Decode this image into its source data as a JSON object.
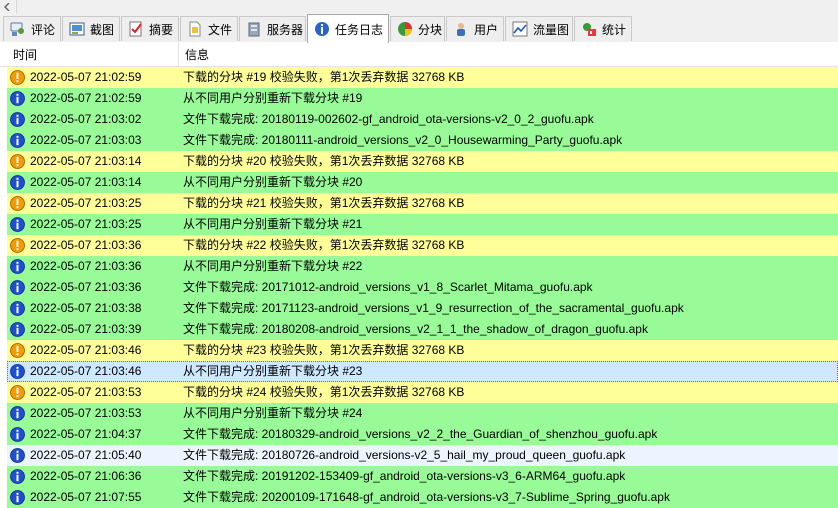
{
  "tabs": [
    {
      "label": "评论",
      "icon": "comment-icon",
      "active": false
    },
    {
      "label": "截图",
      "icon": "screenshot-icon",
      "active": false
    },
    {
      "label": "摘要",
      "icon": "summary-icon",
      "active": false
    },
    {
      "label": "文件",
      "icon": "file-icon",
      "active": false
    },
    {
      "label": "服务器",
      "icon": "server-icon",
      "active": false
    },
    {
      "label": "任务日志",
      "icon": "task-log-icon",
      "active": true
    },
    {
      "label": "分块",
      "icon": "chunk-pie-icon",
      "active": false
    },
    {
      "label": "用户",
      "icon": "user-icon",
      "active": false
    },
    {
      "label": "流量图",
      "icon": "traffic-chart-icon",
      "active": false
    },
    {
      "label": "统计",
      "icon": "statistics-icon",
      "active": false
    }
  ],
  "table": {
    "columns": [
      "时间",
      "信息"
    ],
    "rows": [
      {
        "type": "warn",
        "icon": "warning-icon",
        "time": "2022-05-07 21:02:59",
        "message": "下载的分块 #19 校验失败，第1次丢弃数据 32768 KB"
      },
      {
        "type": "ok",
        "icon": "info-icon",
        "time": "2022-05-07 21:02:59",
        "message": "从不同用户分别重新下载分块 #19"
      },
      {
        "type": "ok",
        "icon": "info-icon",
        "time": "2022-05-07 21:03:02",
        "message": "文件下载完成: 20180119-002602-gf_android_ota-versions-v2_0_2_guofu.apk"
      },
      {
        "type": "ok",
        "icon": "info-icon",
        "time": "2022-05-07 21:03:03",
        "message": "文件下载完成: 20180111-android_versions_v2_0_Housewarming_Party_guofu.apk"
      },
      {
        "type": "warn",
        "icon": "warning-icon",
        "time": "2022-05-07 21:03:14",
        "message": "下载的分块 #20 校验失败，第1次丢弃数据 32768 KB"
      },
      {
        "type": "ok",
        "icon": "info-icon",
        "time": "2022-05-07 21:03:14",
        "message": "从不同用户分别重新下载分块 #20"
      },
      {
        "type": "warn",
        "icon": "warning-icon",
        "time": "2022-05-07 21:03:25",
        "message": "下载的分块 #21 校验失败，第1次丢弃数据 32768 KB"
      },
      {
        "type": "ok",
        "icon": "info-icon",
        "time": "2022-05-07 21:03:25",
        "message": "从不同用户分别重新下载分块 #21"
      },
      {
        "type": "warn",
        "icon": "warning-icon",
        "time": "2022-05-07 21:03:36",
        "message": "下载的分块 #22 校验失败，第1次丢弃数据 32768 KB"
      },
      {
        "type": "ok",
        "icon": "info-icon",
        "time": "2022-05-07 21:03:36",
        "message": "从不同用户分别重新下载分块 #22"
      },
      {
        "type": "ok",
        "icon": "info-icon",
        "time": "2022-05-07 21:03:36",
        "message": "文件下载完成: 20171012-android_versions_v1_8_Scarlet_Mitama_guofu.apk"
      },
      {
        "type": "ok",
        "icon": "info-icon",
        "time": "2022-05-07 21:03:38",
        "message": "文件下载完成: 20171123-android_versions_v1_9_resurrection_of_the_sacramental_guofu.apk"
      },
      {
        "type": "ok",
        "icon": "info-icon",
        "time": "2022-05-07 21:03:39",
        "message": "文件下载完成: 20180208-android_versions_v2_1_1_the_shadow_of_dragon_guofu.apk"
      },
      {
        "type": "warn",
        "icon": "warning-icon",
        "time": "2022-05-07 21:03:46",
        "message": "下载的分块 #23 校验失败，第1次丢弃数据 32768 KB"
      },
      {
        "type": "sel",
        "icon": "info-icon",
        "time": "2022-05-07 21:03:46",
        "message": "从不同用户分别重新下载分块 #23"
      },
      {
        "type": "warn",
        "icon": "warning-icon",
        "time": "2022-05-07 21:03:53",
        "message": "下载的分块 #24 校验失败，第1次丢弃数据 32768 KB"
      },
      {
        "type": "ok",
        "icon": "info-icon",
        "time": "2022-05-07 21:03:53",
        "message": "从不同用户分别重新下载分块 #24"
      },
      {
        "type": "ok",
        "icon": "info-icon",
        "time": "2022-05-07 21:04:37",
        "message": "文件下载完成: 20180329-android_versions_v2_2_the_Guardian_of_shenzhou_guofu.apk"
      },
      {
        "type": "info",
        "icon": "info-icon",
        "time": "2022-05-07 21:05:40",
        "message": "文件下载完成: 20180726-android_versions-v2_5_hail_my_proud_queen_guofu.apk"
      },
      {
        "type": "ok",
        "icon": "info-icon",
        "time": "2022-05-07 21:06:36",
        "message": "文件下载完成: 20191202-153409-gf_android_ota-versions-v3_6-ARM64_guofu.apk"
      },
      {
        "type": "ok",
        "icon": "info-icon",
        "time": "2022-05-07 21:07:55",
        "message": "文件下载完成: 20200109-171648-gf_android_ota-versions-v3_7-Sublime_Spring_guofu.apk"
      }
    ]
  },
  "colors": {
    "warn_row": "#ffff99",
    "ok_row": "#98fb98",
    "selected_row": "#cde8ff",
    "info_row": "#ebf4ff",
    "warning_icon": "#f59a00",
    "info_icon": "#1f4fd0"
  }
}
